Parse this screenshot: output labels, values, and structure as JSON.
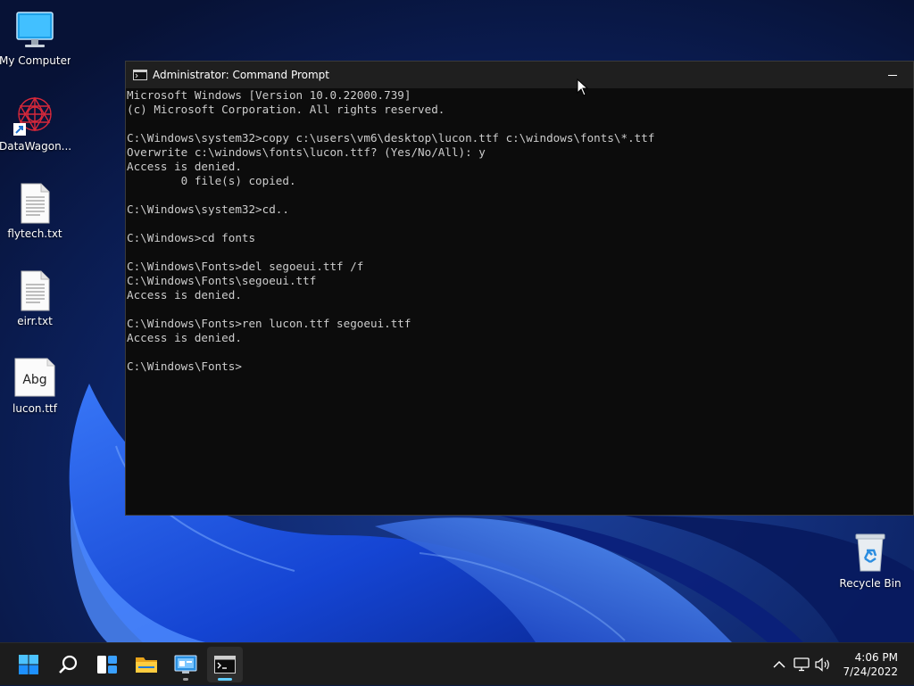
{
  "desktop": {
    "icons": [
      {
        "label": "My Computer",
        "icon": "monitor-icon"
      },
      {
        "label": "DataWagon...",
        "icon": "datawagon-logo-icon"
      },
      {
        "label": "flytech.txt",
        "icon": "text-file-icon"
      },
      {
        "label": "eirr.txt",
        "icon": "text-file-icon"
      },
      {
        "label": "lucon.ttf",
        "icon": "font-file-icon",
        "preview": "Abg"
      },
      {
        "label": "Recycle Bin",
        "icon": "recycle-bin-icon"
      }
    ]
  },
  "window": {
    "title": "Administrator: Command Prompt",
    "icon": "console-icon",
    "lines": [
      "Microsoft Windows [Version 10.0.22000.739]",
      "(c) Microsoft Corporation. All rights reserved.",
      "",
      "C:\\Windows\\system32>copy c:\\users\\vm6\\desktop\\lucon.ttf c:\\windows\\fonts\\*.ttf",
      "Overwrite c:\\windows\\fonts\\lucon.ttf? (Yes/No/All): y",
      "Access is denied.",
      "        0 file(s) copied.",
      "",
      "C:\\Windows\\system32>cd..",
      "",
      "C:\\Windows>cd fonts",
      "",
      "C:\\Windows\\Fonts>del segoeui.ttf /f",
      "C:\\Windows\\Fonts\\segoeui.ttf",
      "Access is denied.",
      "",
      "C:\\Windows\\Fonts>ren lucon.ttf segoeui.ttf",
      "Access is denied.",
      "",
      "C:\\Windows\\Fonts>"
    ]
  },
  "taskbar": {
    "buttons": [
      {
        "name": "start",
        "icon": "windows-start-icon"
      },
      {
        "name": "search",
        "icon": "search-icon"
      },
      {
        "name": "widgets",
        "icon": "widgets-icon"
      },
      {
        "name": "file-explorer",
        "icon": "folder-icon"
      },
      {
        "name": "control-panel",
        "icon": "control-panel-icon",
        "running": true
      },
      {
        "name": "command-prompt",
        "icon": "console-icon",
        "running": true,
        "active": true
      }
    ],
    "tray": {
      "icons": [
        "chevron-up-icon",
        "network-icon",
        "volume-icon"
      ],
      "time": "4:06 PM",
      "date": "7/24/2022"
    }
  },
  "colors": {
    "console_bg": "#0c0c0c",
    "console_text": "#cccccc",
    "titlebar_bg": "#1f1f1f",
    "taskbar_bg": "#1c1c1c",
    "accent": "#60cdff"
  }
}
